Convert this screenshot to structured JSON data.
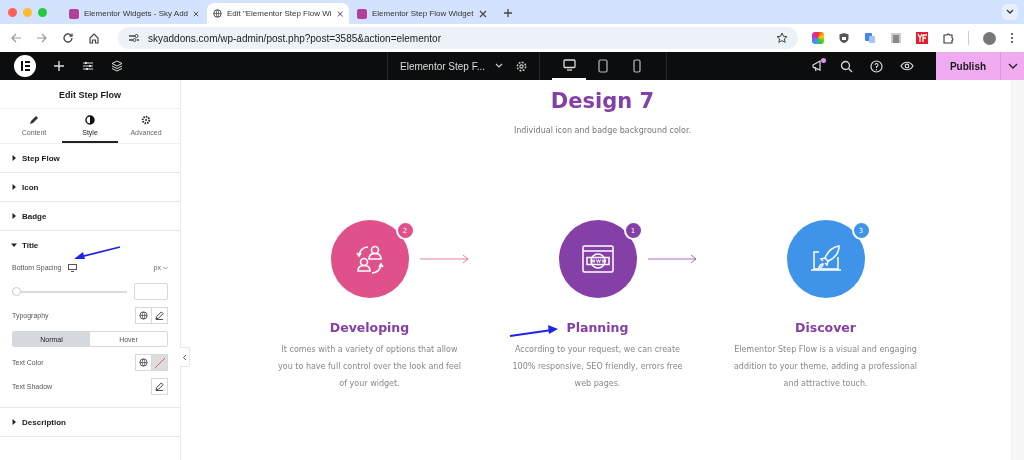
{
  "browser": {
    "tabs": [
      {
        "title": "Elementor Widgets - Sky Add",
        "selected": false,
        "kind": "site"
      },
      {
        "title": "Edit \"Elementor Step Flow Wi",
        "selected": true,
        "kind": "globe"
      },
      {
        "title": "Elementor Step Flow Widget",
        "selected": false,
        "kind": "site"
      }
    ],
    "url": "skyaddons.com/wp-admin/post.php?post=3585&action=elementor"
  },
  "editor_toolbar": {
    "document_title": "Elementor Step F...",
    "devices": [
      {
        "kind": "desktop",
        "selected": true
      },
      {
        "kind": "tablet",
        "selected": false
      },
      {
        "kind": "mobile",
        "selected": false
      }
    ],
    "notification": true,
    "publish": "Publish"
  },
  "panel": {
    "title": "Edit Step Flow",
    "tabs": [
      {
        "label": "Content",
        "kind": "pencil",
        "selected": false
      },
      {
        "label": "Style",
        "kind": "contrast",
        "selected": true
      },
      {
        "label": "Advanced",
        "kind": "gear",
        "selected": false
      }
    ],
    "sections": [
      {
        "label": "Step Flow",
        "expanded": false
      },
      {
        "label": "Icon",
        "expanded": false
      },
      {
        "label": "Badge",
        "expanded": false
      },
      {
        "label": "Title",
        "expanded": true,
        "controls": [
          {
            "kind": "slider",
            "label": "Bottom Spacing",
            "unit": "px",
            "level": 0
          },
          {
            "kind": "typography",
            "label": "Typography"
          },
          {
            "kind": "toggle",
            "options": [
              {
                "label": "Normal",
                "selected": true
              },
              {
                "label": "Hover",
                "selected": false
              }
            ]
          },
          {
            "kind": "color",
            "label": "Text Color"
          },
          {
            "kind": "shadow",
            "label": "Text Shadow"
          }
        ]
      },
      {
        "label": "Description",
        "expanded": false
      }
    ]
  },
  "canvas": {
    "heading": "Design 7",
    "subheading": "Individual icon and badge background color.",
    "steps": [
      {
        "badge": "2",
        "title": "Developing",
        "description": "It comes with a variety of options that allow you to have full control over the look and feel of your widget.",
        "color": "#e0508a"
      },
      {
        "badge": "1",
        "title": "Planning",
        "description": "According to your request, we can create 100% responsive, SEO friendly, errors free web pages.",
        "color": "#8540a8"
      },
      {
        "badge": "3",
        "title": "Discover",
        "description": "Elementor Step Flow is a visual and engaging addition to your theme, adding a professional and attractive touch.",
        "color": "#3f93e8"
      }
    ]
  }
}
